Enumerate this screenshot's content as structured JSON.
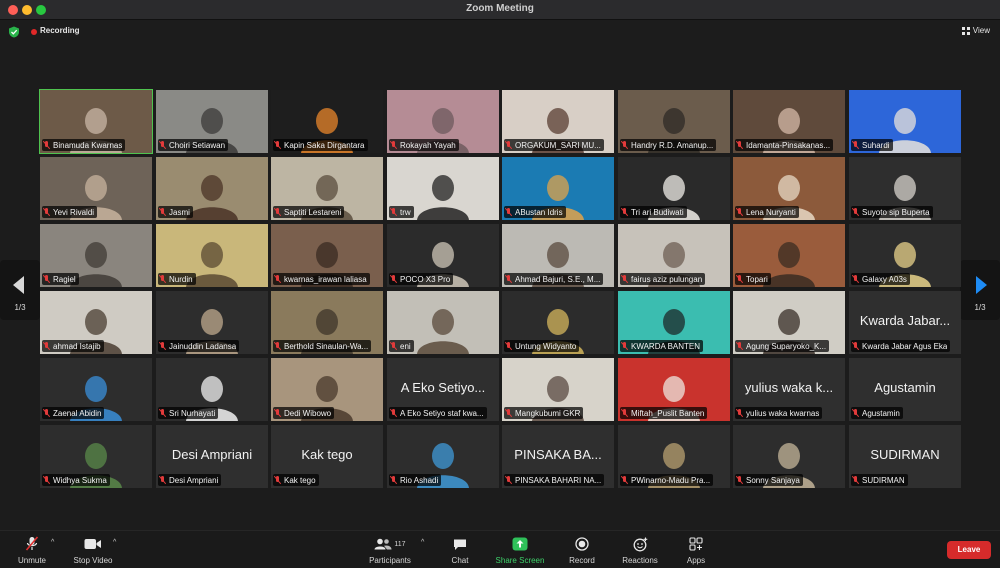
{
  "window": {
    "title": "Zoom Meeting"
  },
  "topbar": {
    "recording_label": "Recording",
    "view_label": "View"
  },
  "pager": {
    "left_page": "1/3",
    "right_page": "1/3"
  },
  "tiles": [
    {
      "name": "Binamuda Kwarnas",
      "video": true,
      "bg": "#6d5a48",
      "fg": "#c9b7a5"
    },
    {
      "name": "Choiri Setiawan",
      "video": true,
      "bg": "#8a8a86",
      "fg": "#3b3a38"
    },
    {
      "name": "Kapin Saka Dirgantara",
      "video": true,
      "bg": "#1e1e1e",
      "fg": "#e8862b"
    },
    {
      "name": "Rokayah Yayah",
      "video": true,
      "bg": "#b58c95",
      "fg": "#6e5a5e"
    },
    {
      "name": "ORGAKUM_SARI MU...",
      "video": true,
      "bg": "#d8cfc6",
      "fg": "#5a3d32"
    },
    {
      "name": "Handry  R.D. Amanup...",
      "video": true,
      "bg": "#6b5c4c",
      "fg": "#2e2a26"
    },
    {
      "name": "Idamanta-Pinsakanas...",
      "video": true,
      "bg": "#5f4a3b",
      "fg": "#d4b9a8"
    },
    {
      "name": "Suhardi",
      "video": true,
      "bg": "#2d66d9",
      "fg": "#e9e3da"
    },
    {
      "name": "Yevi Rivaldi",
      "video": true,
      "bg": "#6e6358",
      "fg": "#c8b39e"
    },
    {
      "name": "Jasmi",
      "video": true,
      "bg": "#9a8c70",
      "fg": "#4a3326"
    },
    {
      "name": "Saptiti Lestareni",
      "video": true,
      "bg": "#bdb5a3",
      "fg": "#5b4d3e"
    },
    {
      "name": "trw",
      "video": true,
      "bg": "#d9d6d0",
      "fg": "#222"
    },
    {
      "name": "ABustan Idris",
      "video": true,
      "bg": "#1b7bb3",
      "fg": "#e0a34a"
    },
    {
      "name": "Tri ari Budiwati",
      "video": true,
      "bg": "#2a2a2a",
      "fg": "#f0ede8"
    },
    {
      "name": "Lena Nuryanti",
      "video": true,
      "bg": "#8c5a3b",
      "fg": "#e7d9c6"
    },
    {
      "name": "Suyoto sip Buperta",
      "video": true,
      "bg": "#2e2e2e",
      "fg": "#d7d3cc"
    },
    {
      "name": "Ragiel",
      "video": true,
      "bg": "#8a857e",
      "fg": "#3f3b36"
    },
    {
      "name": "Nurdin",
      "video": true,
      "bg": "#c9b77a",
      "fg": "#5a4a33"
    },
    {
      "name": "kwarnas_irawan laliasa",
      "video": true,
      "bg": "#7a5f4d",
      "fg": "#3a2a22"
    },
    {
      "name": "POCO X3 Pro",
      "video": true,
      "bg": "#2b2b2b",
      "fg": "#cfc7b8"
    },
    {
      "name": "Ahmad Bajuri, S.E., M...",
      "video": true,
      "bg": "#bcbab4",
      "fg": "#5a4a3e"
    },
    {
      "name": "fairus aziz pulungan",
      "video": true,
      "bg": "#c7c2ba",
      "fg": "#6e5e53"
    },
    {
      "name": "Topari",
      "video": true,
      "bg": "#9a5c3c",
      "fg": "#3a2c22"
    },
    {
      "name": "Galaxy A03s",
      "video": true,
      "bg": "#2c2c2c",
      "fg": "#e8d28a"
    },
    {
      "name": "ahmad Istajib",
      "video": true,
      "bg": "#cfcbc3",
      "fg": "#4a3d31"
    },
    {
      "name": "Jainuddin Ladansa",
      "video": true,
      "bg": "#2d2d2d",
      "fg": "#bfa98e"
    },
    {
      "name": "Berthold Sinaulan-Wa...",
      "video": true,
      "bg": "#8a7a5c",
      "fg": "#3d362a"
    },
    {
      "name": "eni",
      "video": true,
      "bg": "#c2bfb7",
      "fg": "#5a4a3b"
    },
    {
      "name": "Untung Widyanto",
      "video": true,
      "bg": "#2c2c2c",
      "fg": "#d4b65c"
    },
    {
      "name": "KWARDA BANTEN",
      "video": true,
      "bg": "#3bbdb0",
      "fg": "#1e2a2a"
    },
    {
      "name": "Agung Suparyoko_K...",
      "video": true,
      "bg": "#d0cdc5",
      "fg": "#3a2f28"
    },
    {
      "name": "Kwarda Jabar Agus Eka",
      "video": false,
      "big": "Kwarda Jabar..."
    },
    {
      "name": "Zaenal Abidin",
      "video": true,
      "bg": "#2d2d2d",
      "fg": "#3a8fd9"
    },
    {
      "name": "Sri Nurhayati",
      "video": true,
      "bg": "#2d2d2d",
      "fg": "#f2f2f2"
    },
    {
      "name": "Dedi Wibowo",
      "video": true,
      "bg": "#a8957d",
      "fg": "#4a3a2c"
    },
    {
      "name": "A Eko Setiyo staf kwa...",
      "video": false,
      "big": "A Eko Setiyo..."
    },
    {
      "name": "Mangkubumi GKR",
      "video": true,
      "bg": "#d7d3ca",
      "fg": "#5a4a42"
    },
    {
      "name": "Miftah_Puslit Banten",
      "video": true,
      "bg": "#c9332d",
      "fg": "#ece6dd"
    },
    {
      "name": "yulius waka kwarnas",
      "video": false,
      "big": "yulius waka k..."
    },
    {
      "name": "Agustamin",
      "video": false,
      "big": "Agustamin"
    },
    {
      "name": "Widhya Sukma",
      "video": true,
      "bg": "#2d2d2d",
      "fg": "#5a8a4a"
    },
    {
      "name": "Desi Ampriani",
      "video": false,
      "big": "Desi Ampriani"
    },
    {
      "name": "Kak tego",
      "video": false,
      "big": "Kak tego"
    },
    {
      "name": "Rio Ashadi",
      "video": true,
      "bg": "#2d2d2d",
      "fg": "#3f9ad8"
    },
    {
      "name": "PINSAKA BAHARI NA...",
      "video": false,
      "big": "PINSAKA BA..."
    },
    {
      "name": "PWinarno-Madu Pra...",
      "video": true,
      "bg": "#2d2d2d",
      "fg": "#b8a070"
    },
    {
      "name": "Sonny Sanjaya",
      "video": true,
      "bg": "#2d2d2d",
      "fg": "#c4b59a"
    },
    {
      "name": "SUDIRMAN",
      "video": false,
      "big": "SUDIRMAN"
    }
  ],
  "toolbar": {
    "unmute_label": "Unmute",
    "stop_video_label": "Stop Video",
    "participants_label": "Participants",
    "participants_count": "117",
    "chat_label": "Chat",
    "share_label": "Share Screen",
    "record_label": "Record",
    "reactions_label": "Reactions",
    "apps_label": "Apps",
    "leave_label": "Leave",
    "share_color": "#3ed16a",
    "leave_color": "#d62b2b"
  }
}
